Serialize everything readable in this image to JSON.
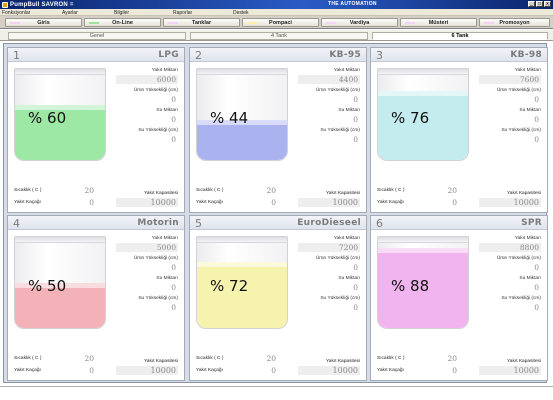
{
  "window": {
    "app_title": "PumpBull SAVRON",
    "app_title_suffix": "=",
    "center_title": "THE AUTOMATION",
    "minimize": "_",
    "maximize": "□",
    "close": "x"
  },
  "menu": [
    "Fonksiyonlar",
    "Ayarlar",
    "Bilgiler",
    "Raporlar",
    "Destek"
  ],
  "nav": [
    {
      "label": "Giris",
      "ind": "#f2d0f0"
    },
    {
      "label": "On-Line",
      "ind": "#9fe59f"
    },
    {
      "label": "Tanklar",
      "ind": "#f0d4f2"
    },
    {
      "label": "Pompaci",
      "ind": "#fff1a8"
    },
    {
      "label": "Vardiya",
      "ind": "#f3d5f5"
    },
    {
      "label": "Müsteri",
      "ind": "#f5d3f0"
    },
    {
      "label": "Promosyon",
      "ind": "#f4d2f0"
    }
  ],
  "subtabs": [
    "Genel",
    "4 Tank",
    "6 Tank"
  ],
  "labels": {
    "yakit_miktari": "Yakıt Miktarı",
    "urun_yuksekligi": "Ürün Yüksekliği (cm)",
    "su_miktari": "Su Miktarı",
    "su_yuksekligi": "Su Yüksekliği (cm)",
    "sicaklik": "Sıcaklık ( C )",
    "yakit_kacagi": "Yakıt Kaçağı",
    "yakit_kapasitesi": "Yakıt Kapasitesi"
  },
  "tanks": [
    {
      "no": "1",
      "name": "LPG",
      "percent_text": "% 60",
      "level": 60,
      "color": "#9ee8a6",
      "yakit_miktari": "6000",
      "urun_yuksekligi": "0",
      "su_miktari": "0",
      "su_yuksekligi": "0",
      "sicaklik": "20",
      "yakit_kacagi": "0",
      "kapasite": "10000"
    },
    {
      "no": "2",
      "name": "KB-95",
      "percent_text": "% 44",
      "level": 44,
      "color": "#aab2f0",
      "yakit_miktari": "4400",
      "urun_yuksekligi": "0",
      "su_miktari": "0",
      "su_yuksekligi": "0",
      "sicaklik": "20",
      "yakit_kacagi": "0",
      "kapasite": "10000"
    },
    {
      "no": "3",
      "name": "KB-98",
      "percent_text": "% 76",
      "level": 76,
      "color": "#c4ecee",
      "yakit_miktari": "7600",
      "urun_yuksekligi": "0",
      "su_miktari": "0",
      "su_yuksekligi": "0",
      "sicaklik": "20",
      "yakit_kacagi": "0",
      "kapasite": "10000"
    },
    {
      "no": "4",
      "name": "Motorin",
      "percent_text": "% 50",
      "level": 50,
      "color": "#f2b2b8",
      "yakit_miktari": "5000",
      "urun_yuksekligi": "0",
      "su_miktari": "0",
      "su_yuksekligi": "0",
      "sicaklik": "20",
      "yakit_kacagi": "0",
      "kapasite": "10000"
    },
    {
      "no": "5",
      "name": "EuroDieseel",
      "percent_text": "% 72",
      "level": 72,
      "color": "#f6f3ae",
      "yakit_miktari": "7200",
      "urun_yuksekligi": "0",
      "su_miktari": "0",
      "su_yuksekligi": "0",
      "sicaklik": "20",
      "yakit_kacagi": "0",
      "kapasite": "10000"
    },
    {
      "no": "6",
      "name": "SPR",
      "percent_text": "% 88",
      "level": 88,
      "color": "#f2b4ee",
      "yakit_miktari": "8800",
      "urun_yuksekligi": "0",
      "su_miktari": "0",
      "su_yuksekligi": "0",
      "sicaklik": "20",
      "yakit_kacagi": "0",
      "kapasite": "10000"
    }
  ]
}
